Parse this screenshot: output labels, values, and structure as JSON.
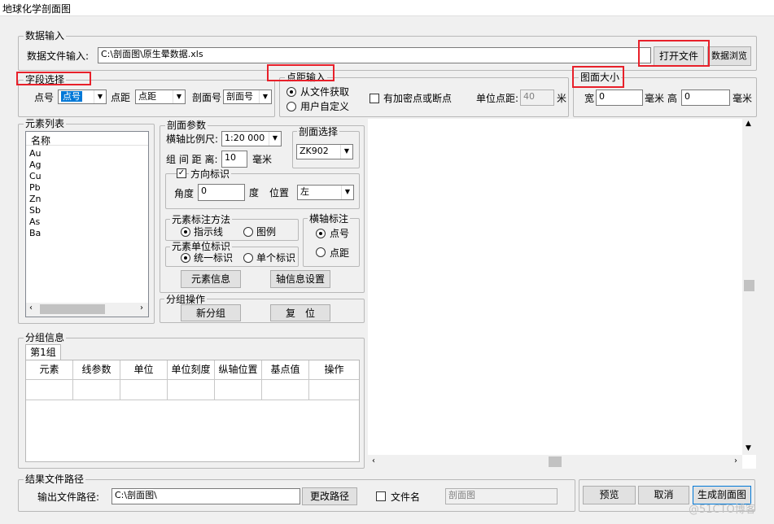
{
  "window": {
    "title": "地球化学剖面图"
  },
  "data_input": {
    "group_title": "数据输入",
    "file_label": "数据文件输入:",
    "file_path": "C:\\剖面图\\原生晕数据.xls",
    "open_button": "打开文件",
    "browse_button": "数据浏览"
  },
  "field_select": {
    "group_title": "字段选择",
    "point_label": "点号",
    "point_value": "点号",
    "distance_label": "点距",
    "distance_value": "点距",
    "section_label": "剖面号",
    "section_value": "剖面号"
  },
  "spacing_input": {
    "group_title": "点距输入",
    "from_file": "从文件获取",
    "user_defined": "用户自定义",
    "densify_label": "有加密点或断点",
    "unit_label": "单位点距:",
    "unit_value": "40",
    "unit_suffix": "米"
  },
  "canvas_size": {
    "group_title": "图面大小",
    "width_label": "宽",
    "width_value": "0",
    "width_unit": "毫米",
    "height_label": "高",
    "height_value": "0",
    "height_unit": "毫米"
  },
  "element_list": {
    "group_title": "元素列表",
    "header": "名称",
    "items": [
      "Au",
      "Ag",
      "Cu",
      "Pb",
      "Zn",
      "Sb",
      "As",
      "Ba"
    ]
  },
  "section_params": {
    "group_title": "剖面参数",
    "scale_label": "横轴比例尺:",
    "scale_value": "1:20 000",
    "gap_label": "组 间 距 离:",
    "gap_value": "10",
    "gap_unit": "毫米",
    "section_select_title": "剖面选择",
    "section_select_value": "ZK902",
    "direction_title": "方向标识",
    "angle_label": "角度",
    "angle_value": "0",
    "angle_unit": "度",
    "position_label": "位置",
    "position_value": "左",
    "annot_method_title": "元素标注方法",
    "annot_leader": "指示线",
    "annot_legend": "图例",
    "unit_mark_title": "元素单位标识",
    "unit_unified": "统一标识",
    "unit_single": "单个标识",
    "axis_annot_title": "横轴标注",
    "axis_point": "点号",
    "axis_distance": "点距",
    "elem_info_button": "元素信息",
    "axis_info_button": "轴信息设置"
  },
  "group_ops": {
    "group_title": "分组操作",
    "new_group_button": "新分组",
    "reset_button": "复　位"
  },
  "group_info": {
    "group_title": "分组信息",
    "tab": "第1组",
    "columns": [
      "元素",
      "线参数",
      "单位",
      "单位刻度",
      "纵轴位置",
      "基点值",
      "操作"
    ]
  },
  "result_path": {
    "group_title": "结果文件路径",
    "output_label": "输出文件路径:",
    "output_value": "C:\\剖面图\\",
    "change_button": "更改路径",
    "filename_label": "文件名",
    "filename_placeholder": "剖面图"
  },
  "actions": {
    "preview": "预览",
    "cancel": "取消",
    "generate": "生成剖面图"
  },
  "watermark": "@51CTO博客"
}
